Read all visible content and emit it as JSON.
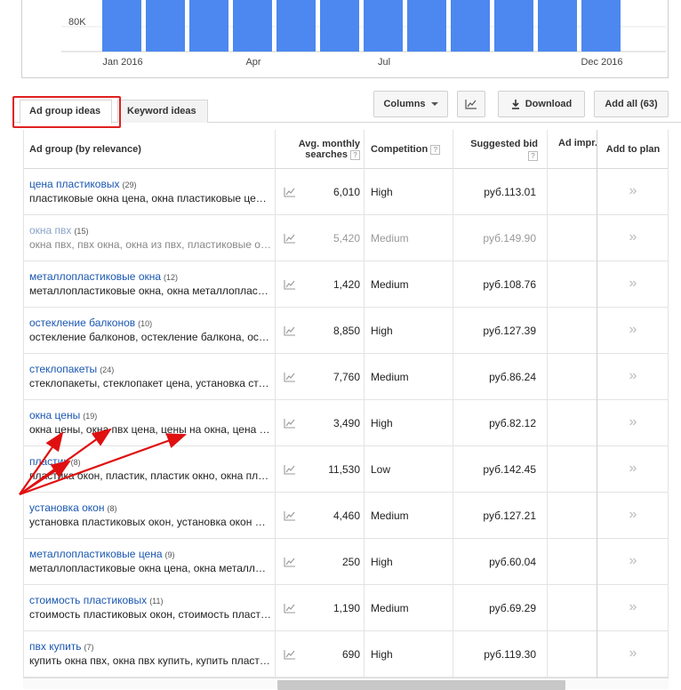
{
  "chart": {
    "y_tick": "80K",
    "x_ticks": [
      "Jan 2016",
      "Apr",
      "Jul",
      "Dec 2016"
    ],
    "bar_color": "#4c88ef"
  },
  "tabs": {
    "ad_group_ideas": "Ad group ideas",
    "keyword_ideas": "Keyword ideas"
  },
  "toolbar": {
    "columns_label": "Columns",
    "chart_icon": "trend-chart-icon",
    "download_label": "Download",
    "add_all_label": "Add all (63)"
  },
  "table": {
    "headers": {
      "ad_group": "Ad group (by relevance)",
      "avg_monthly_1": "Avg. monthly",
      "avg_monthly_2": "searches",
      "competition": "Competition",
      "suggested_bid": "Suggested bid",
      "ad_impr": "Ad impr.",
      "add_to_plan": "Add to plan",
      "help_mark": "?"
    },
    "rows": [
      {
        "group": "цена пластиковых",
        "count": "(29)",
        "keywords": "пластиковые окна цена, окна пластиковые цена, окна пластиковые",
        "searches": "6,010",
        "competition": "High",
        "bid": "руб.113.01",
        "add": "»"
      },
      {
        "group": "окна пвх",
        "count": "(15)",
        "keywords": "окна пвх, пвх окна, окна из пвх, пластиковые окна пвх",
        "searches": "5,420",
        "competition": "Medium",
        "bid": "руб.149.90",
        "add": "»"
      },
      {
        "group": "металлопластиковые окна",
        "count": "(12)",
        "keywords": "металлопластиковые окна, окна металлопластиковые",
        "searches": "1,420",
        "competition": "Medium",
        "bid": "руб.108.76",
        "add": "»"
      },
      {
        "group": "остекление балконов",
        "count": "(10)",
        "keywords": "остекление балконов, остекление балкона, остекление лоджий",
        "searches": "8,850",
        "competition": "High",
        "bid": "руб.127.39",
        "add": "»"
      },
      {
        "group": "стеклопакеты",
        "count": "(24)",
        "keywords": "стеклопакеты, стеклопакет цена, установка стеклопакетов",
        "searches": "7,760",
        "competition": "Medium",
        "bid": "руб.86.24",
        "add": "»"
      },
      {
        "group": "окна цены",
        "count": "(19)",
        "keywords": "окна цены, окна пвх цена, цены на окна, цена окон",
        "searches": "3,490",
        "competition": "High",
        "bid": "руб.82.12",
        "add": "»"
      },
      {
        "group": "пластик",
        "count": "(8)",
        "keywords": "пластика окон, пластик, пластик окно, окна пластик",
        "searches": "11,530",
        "competition": "Low",
        "bid": "руб.142.45",
        "add": "»"
      },
      {
        "group": "установка окон",
        "count": "(8)",
        "keywords": "установка пластиковых окон, установка окон пвх",
        "searches": "4,460",
        "competition": "Medium",
        "bid": "руб.127.21",
        "add": "»"
      },
      {
        "group": "металлопластиковые цена",
        "count": "(9)",
        "keywords": "металлопластиковые окна цена, окна металлопластиковые цена",
        "searches": "250",
        "competition": "High",
        "bid": "руб.60.04",
        "add": "»"
      },
      {
        "group": "стоимость пластиковых",
        "count": "(11)",
        "keywords": "стоимость пластиковых окон, стоимость пластиковых окон пвх",
        "searches": "1,190",
        "competition": "Medium",
        "bid": "руб.69.29",
        "add": "»"
      },
      {
        "group": "пвх купить",
        "count": "(7)",
        "keywords": "купить окна пвх, окна пвх купить, купить пластиковые окна",
        "searches": "690",
        "competition": "High",
        "bid": "руб.119.30",
        "add": "»"
      }
    ]
  }
}
